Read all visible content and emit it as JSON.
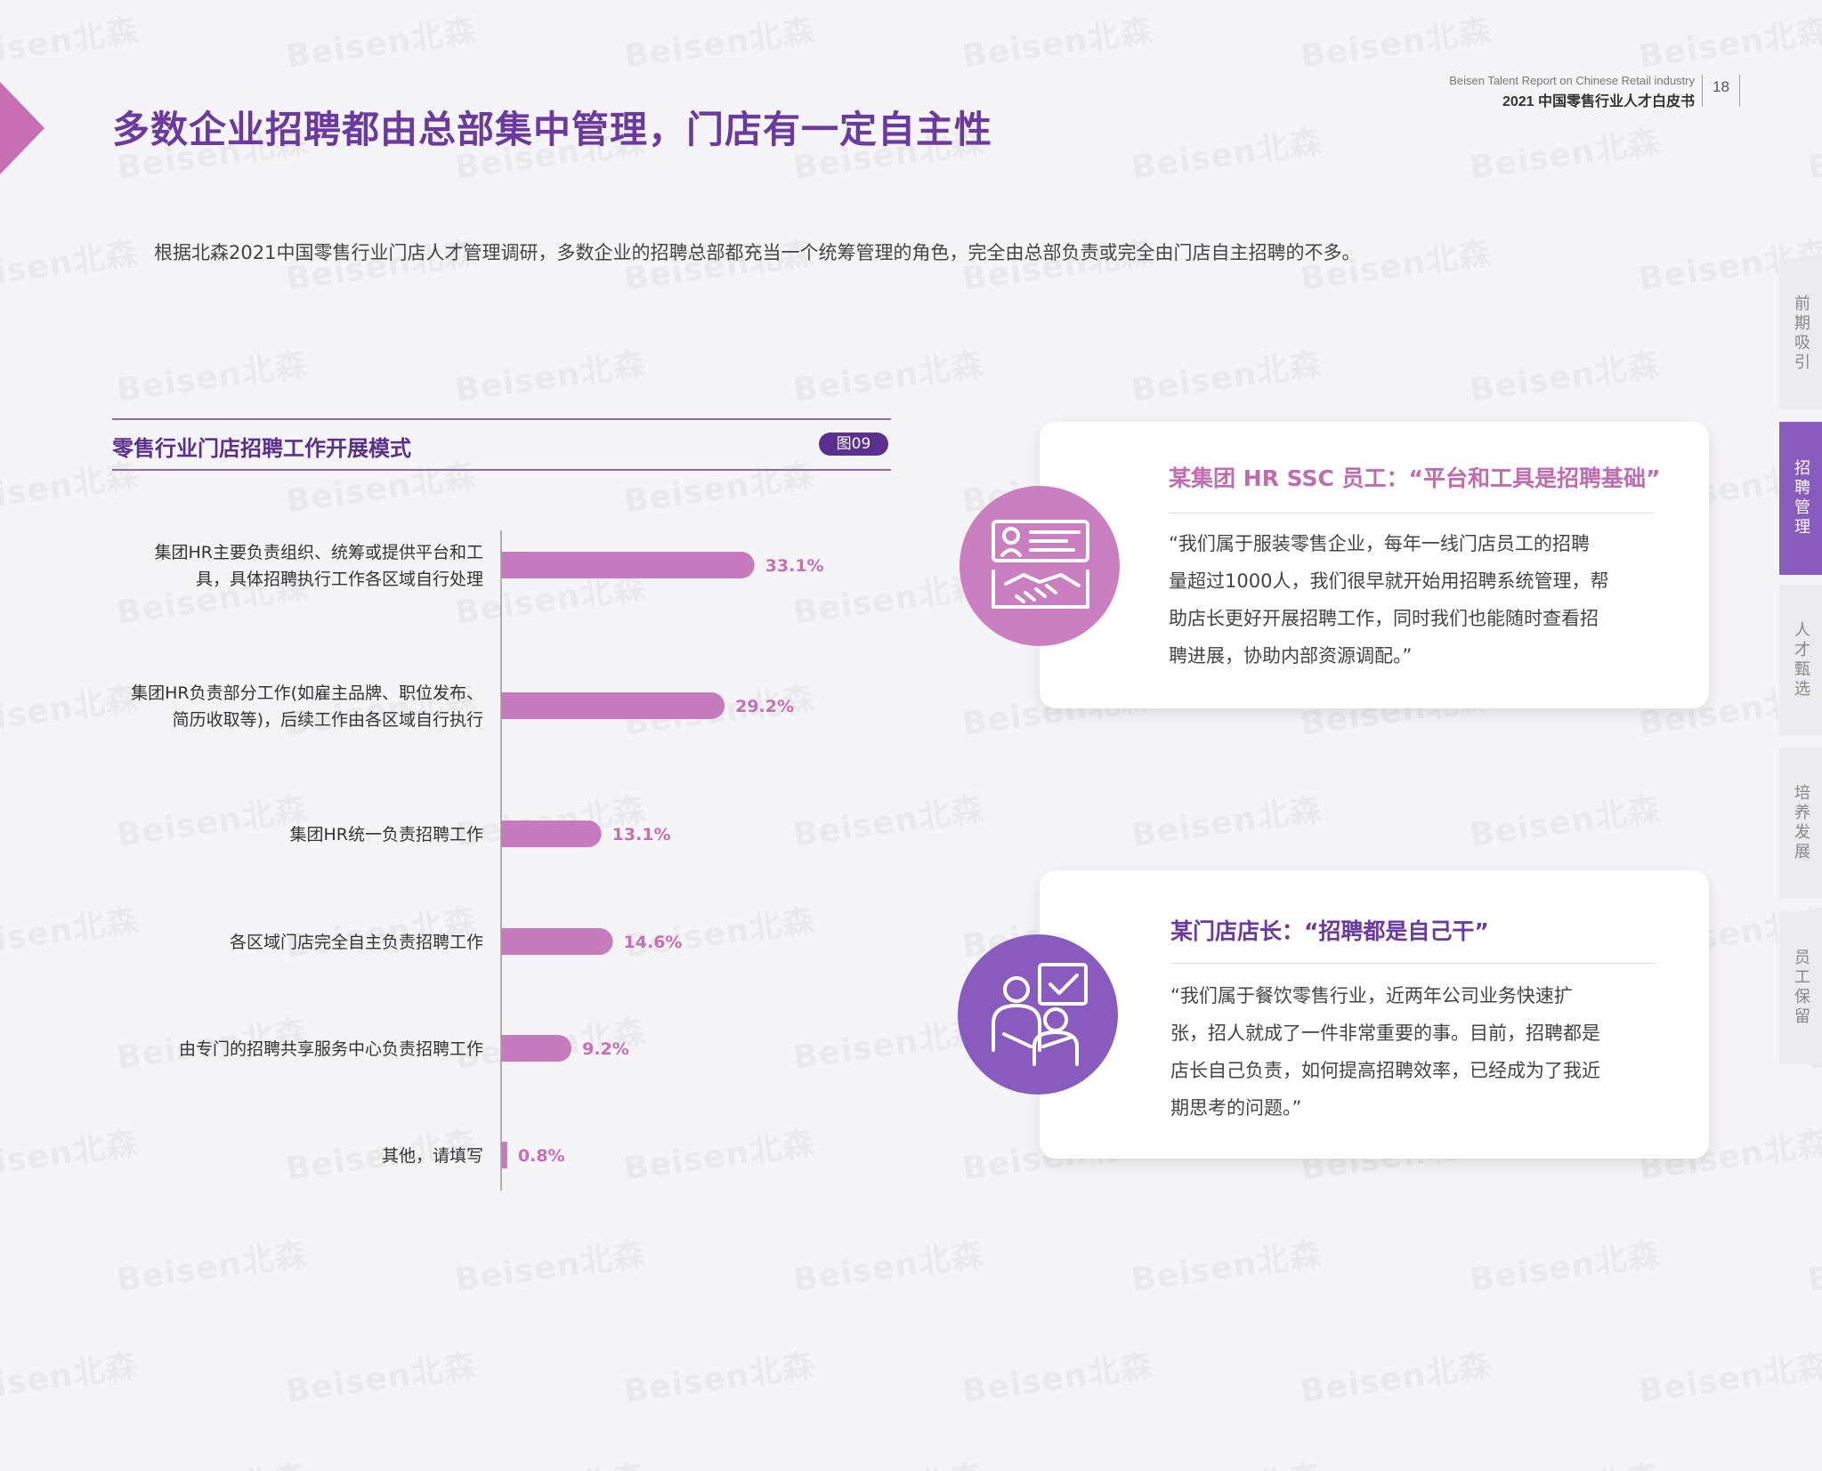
{
  "header": {
    "en_subtitle": "Beisen Talent Report on Chinese Retail industry",
    "cn_subtitle": "2021 中国零售行业人才白皮书",
    "page_number": "18"
  },
  "page_title": "多数企业招聘都由总部集中管理，门店有一定自主性",
  "intro": "根据北森2021中国零售行业门店人才管理调研，多数企业的招聘总部都充当一个统筹管理的角色，完全由总部负责或完全由门店自主招聘的不多。",
  "chart_title": "零售行业门店招聘工作开展模式",
  "fig_badge": "图09",
  "chart_data": {
    "type": "bar",
    "orientation": "horizontal",
    "categories": [
      [
        "集团HR主要负责组织、统筹或提供平台和工",
        "具，具体招聘执行工作各区域自行处理"
      ],
      [
        "集团HR负责部分工作(如雇主品牌、职位发布、",
        "简历收取等)，后续工作由各区域自行执行"
      ],
      [
        "集团HR统一负责招聘工作"
      ],
      [
        "各区域门店完全自主负责招聘工作"
      ],
      [
        "由专门的招聘共享服务中心负责招聘工作"
      ],
      [
        "其他，请填写"
      ]
    ],
    "values": [
      33.1,
      29.2,
      13.1,
      14.6,
      9.2,
      0.8
    ],
    "value_labels": [
      "33.1%",
      "29.2%",
      "13.1%",
      "14.6%",
      "9.2%",
      "0.8%"
    ],
    "unit": "%",
    "bar_color": "#c67bbf",
    "grid": false,
    "legend": "none"
  },
  "quotes": [
    {
      "title": "某集团 HR SSC 员工：“平台和工具是招聘基础”",
      "lines": [
        "“我们属于服装零售企业，每年一线门店员工的招聘",
        "量超过1000人，我们很早就开始用招聘系统管理，帮",
        "助店长更好开展招聘工作，同时我们也能随时查看招",
        "聘进展，协助内部资源调配。”"
      ],
      "icon": "handshake-resume-icon",
      "color": "#c97fc0"
    },
    {
      "title": "某门店店长：“招聘都是自己干”",
      "lines": [
        "“我们属于餐饮零售行业，近两年公司业务快速扩",
        "张，招人就成了一件非常重要的事。目前，招聘都是",
        "店长自己负责，如何提高招聘效率，已经成为了我近",
        "期思考的问题。”"
      ],
      "icon": "team-approval-icon",
      "color": "#8a5bbf"
    }
  ],
  "side_tabs": [
    {
      "label": "前期吸引",
      "active": false
    },
    {
      "label": "招聘管理",
      "active": true
    },
    {
      "label": "人才甄选",
      "active": false
    },
    {
      "label": "培养发展",
      "active": false
    },
    {
      "label": "员工保留",
      "active": false
    }
  ],
  "watermark": "Beisen北森",
  "colors": {
    "title_purple": "#6a3aa0",
    "accent_pink": "#c86fb4",
    "accent_purple": "#8a5bbf"
  }
}
